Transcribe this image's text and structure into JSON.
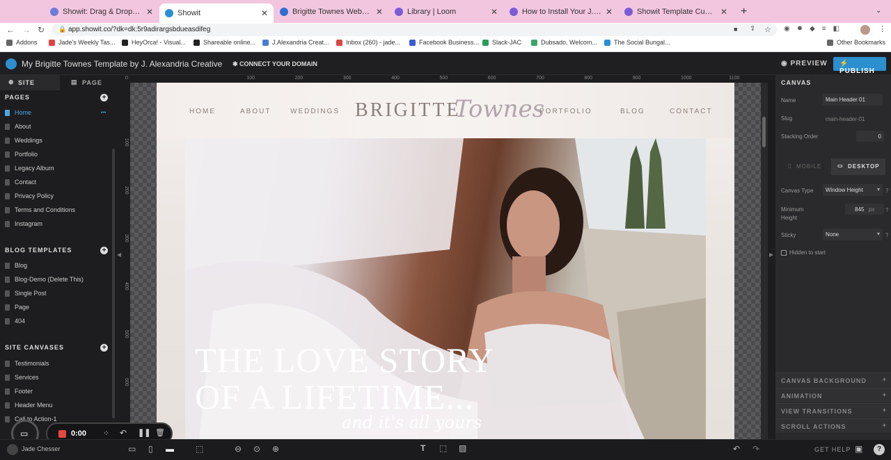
{
  "browser": {
    "tabs": [
      {
        "title": "Showit: Drag & Drop Website B",
        "color": "#6b7bd6",
        "active": false
      },
      {
        "title": "Showit",
        "color": "#2b8fd6",
        "active": true
      },
      {
        "title": "Brigitte Townes Website Launc",
        "color": "#2e6fd0",
        "active": false
      },
      {
        "title": "Library | Loom",
        "color": "#7b5cd6",
        "active": false
      },
      {
        "title": "How to Install Your J. Alexandri",
        "color": "#7b5cd6",
        "active": false
      },
      {
        "title": "Showit Template Customizatio",
        "color": "#7b5cd6",
        "active": false
      }
    ],
    "new_tab_icon": "plus-icon",
    "url": "app.showit.co/?dk=dk:5r9adirargsbdueasdifeg",
    "bookmarks": [
      {
        "label": "Addons",
        "color": "#666"
      },
      {
        "label": "Jade's Weekly Tas...",
        "color": "#d44"
      },
      {
        "label": "HeyOrca! - Visual...",
        "color": "#222"
      },
      {
        "label": "Shareable online...",
        "color": "#222"
      },
      {
        "label": "J.Alexandria Creat...",
        "color": "#4a7bd6"
      },
      {
        "label": "Inbox (260) - jade...",
        "color": "#d44"
      },
      {
        "label": "Facebook Business...",
        "color": "#3b5bd6"
      },
      {
        "label": "Slack-JAC",
        "color": "#2a9d5a"
      },
      {
        "label": "Dubsado, Welcom...",
        "color": "#3aa56a"
      },
      {
        "label": "The Social Bungal...",
        "color": "#2b8fd6"
      }
    ],
    "other_bookmarks": "Other Bookmarks"
  },
  "app": {
    "title": "My Brigitte Townes Template by J. Alexandria Creative",
    "connect_domain": "CONNECT YOUR DOMAIN",
    "preview": "PREVIEW",
    "publish": "PUBLISH",
    "accent": "#2c8fcf"
  },
  "left": {
    "tab_site": "SITE",
    "tab_page": "PAGE",
    "pages_heading": "PAGES",
    "pages": [
      "Home",
      "About",
      "Weddings",
      "Portfolio",
      "Legacy Album",
      "Contact",
      "Privacy Policy",
      "Terms and Conditions",
      "Instagram"
    ],
    "blog_heading": "BLOG TEMPLATES",
    "blog_templates": [
      "Blog",
      "Blog-Demo (Delete This)",
      "Single Post",
      "Page",
      "404"
    ],
    "canvases_heading": "SITE CANVASES",
    "canvases": [
      "Testimonials",
      "Services",
      "Footer",
      "Header Menu",
      "Call to Action-1"
    ]
  },
  "ruler": {
    "top": [
      "0",
      "100",
      "200",
      "300",
      "400",
      "500",
      "600",
      "700",
      "800",
      "900",
      "1000",
      "1100"
    ],
    "left": [
      "100",
      "200",
      "300",
      "400",
      "500",
      "600"
    ]
  },
  "site": {
    "nav_left": [
      "HOME",
      "ABOUT",
      "WEDDINGS"
    ],
    "logo_main": "BRIGITTE",
    "logo_script": "Townes",
    "nav_right": [
      "PORTFOLIO",
      "BLOG",
      "CONTACT"
    ],
    "hero_line1": "THE LOVE STORY",
    "hero_line2": "OF A LIFETIME...",
    "hero_script": "and it's all yours"
  },
  "right": {
    "canvas_heading": "CANVAS",
    "name_label": "Name",
    "name_value": "Main Header 01",
    "slug_label": "Slug",
    "slug_value": "main-header-01",
    "stacking_label": "Stacking Order",
    "stacking_value": "0",
    "mobile_tab": "MOBILE",
    "desktop_tab": "DESKTOP",
    "canvas_type_label": "Canvas Type",
    "canvas_type_value": "Window Height",
    "min_height_label": "Minimum Height",
    "min_height_value": "845",
    "min_height_unit": "px",
    "sticky_label": "Sticky",
    "sticky_value": "None",
    "hidden_label": "Hidden to start",
    "sections": [
      "CANVAS BACKGROUND",
      "ANIMATION",
      "VIEW TRANSITIONS",
      "SCROLL ACTIONS"
    ]
  },
  "recorder": {
    "time": "0:00"
  },
  "bottom": {
    "user": "Jade Chesser",
    "help": "GET HELP"
  }
}
